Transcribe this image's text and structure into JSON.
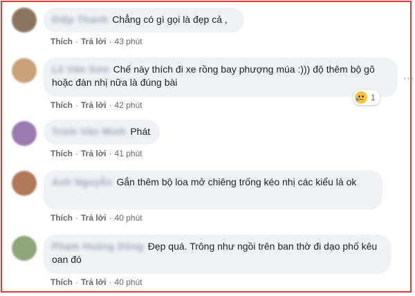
{
  "colors": {
    "frame": "#e53935",
    "bubble": "#f0f2f5",
    "meta": "#65676b"
  },
  "comments": [
    {
      "author": "Diệp Thanh",
      "text": "Chẳng có gì gọi là đẹp cả ,",
      "like_label": "Thích",
      "reply_label": "Trả lời",
      "time": "43 phút",
      "avatar_color": "#8a7560"
    },
    {
      "author": "Lê Văn Sơn",
      "text": "Chế này thích đi xe rồng bay phượng múa :))) độ thêm bộ gõ hoặc đàn nhị nữa là đúng bài",
      "like_label": "Thích",
      "reply_label": "Trả lời",
      "time": "42 phút",
      "avatar_color": "#c9a27a",
      "reaction": {
        "icon": "sad-face-icon",
        "count": "1"
      }
    },
    {
      "author": "Trịnh Văn Minh",
      "text": "Phát",
      "like_label": "Thích",
      "reply_label": "Trả lời",
      "time": "41 phút",
      "avatar_color": "#9b7bb0"
    },
    {
      "author": "Anh Nguyễn",
      "text": "Gắn thêm bộ loa mở chiêng trống kéo nhị các kiểu là ok",
      "like_label": "Thích",
      "reply_label": "Trả lời",
      "time": "40 phút",
      "avatar_color": "#b07a5a"
    },
    {
      "author": "Phạm Hoàng Dũng",
      "text": "Đẹp quá. Trông như ngồi trên ban thờ đi dạo phố kêu oan đó",
      "like_label": "Thích",
      "reply_label": "Trả lời",
      "time": "40 phút",
      "avatar_color": "#8fa57a"
    }
  ]
}
